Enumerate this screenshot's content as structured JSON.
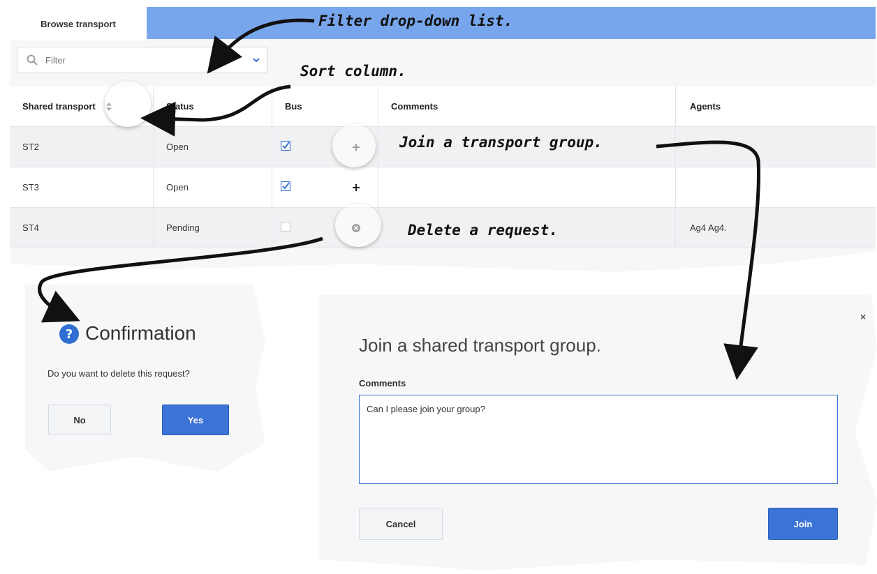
{
  "tab": {
    "label": "Browse transport"
  },
  "filter": {
    "placeholder": "Filter"
  },
  "table": {
    "columns": [
      "Shared transport",
      "Status",
      "Bus",
      "Comments",
      "Agents"
    ],
    "rows": [
      {
        "shared_transport": "ST2",
        "status": "Open",
        "bus_checked": true,
        "action": "+",
        "comments": "",
        "agents": ""
      },
      {
        "shared_transport": "ST3",
        "status": "Open",
        "bus_checked": true,
        "action": "+",
        "comments": "",
        "agents": ""
      },
      {
        "shared_transport": "ST4",
        "status": "Pending",
        "bus_checked": false,
        "action": "delete",
        "comments": "",
        "agents": "Ag4 Ag4."
      }
    ]
  },
  "annotations": {
    "filter": "Filter drop-down list.",
    "sort": "Sort column.",
    "join": "Join a transport group.",
    "delete": "Delete a request."
  },
  "confirmation": {
    "title": "Confirmation",
    "message": "Do you want to delete this request?",
    "no_label": "No",
    "yes_label": "Yes"
  },
  "join_dialog": {
    "title": "Join a shared transport group.",
    "close_label": "×",
    "comments_label": "Comments",
    "comments_value": "Can I please join your group?",
    "cancel_label": "Cancel",
    "join_label": "Join"
  },
  "colors": {
    "accent": "#3b73d6",
    "tabbar": "#78a6ec",
    "panel": "#f6f7f8"
  }
}
